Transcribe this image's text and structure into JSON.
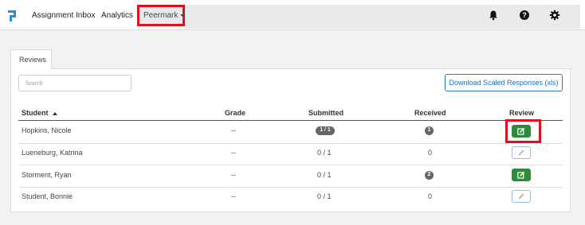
{
  "nav": {
    "logo_icon": "turnitin-logo-icon",
    "items": [
      {
        "label": "Assignment Inbox"
      },
      {
        "label": "Analytics"
      }
    ],
    "peermark": {
      "label": "Peermark"
    },
    "icons": [
      "bell-icon",
      "help-icon",
      "gear-icon"
    ]
  },
  "tabs": [
    {
      "label": "Reviews"
    }
  ],
  "search": {
    "placeholder": "Search"
  },
  "download_button": {
    "label": "Download Scaled Responses (xls)"
  },
  "table": {
    "columns": [
      "Student",
      "Grade",
      "Submitted",
      "Received",
      "Review"
    ],
    "rows": [
      {
        "student": "Hopkins, Nicole",
        "grade": "--",
        "submitted": "1 / 1",
        "submitted_badge": true,
        "received": "1",
        "received_badge": true,
        "review": "edit-active"
      },
      {
        "student": "Lueneburg, Katrina",
        "grade": "--",
        "submitted": "0 / 1",
        "submitted_badge": false,
        "received": "0",
        "received_badge": false,
        "review": "edit-inactive"
      },
      {
        "student": "Storment, Ryan",
        "grade": "--",
        "submitted": "0 / 1",
        "submitted_badge": false,
        "received": "2",
        "received_badge": true,
        "review": "edit-active"
      },
      {
        "student": "Student, Bonnie",
        "grade": "--",
        "submitted": "0 / 1",
        "submitted_badge": false,
        "received": "0",
        "received_badge": false,
        "review": "edit-inactive"
      }
    ]
  },
  "colors": {
    "highlight": "#e0101d",
    "accent_blue": "#2a7dc9",
    "review_green": "#2e8b3a"
  }
}
